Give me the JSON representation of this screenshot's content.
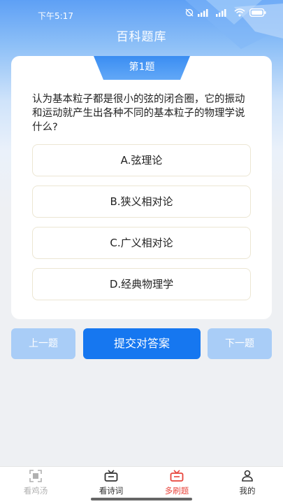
{
  "status_bar": {
    "time": "下午5:17"
  },
  "header": {
    "title": "百科题库"
  },
  "quiz": {
    "number_label": "第1题",
    "question": "认为基本粒子都是很小的弦的闭合圈，它的振动和运动就产生出各种不同的基本粒子的物理学说什么?",
    "options": [
      {
        "label": "A.弦理论"
      },
      {
        "label": "B.狭义相对论"
      },
      {
        "label": "C.广义相对论"
      },
      {
        "label": "D.经典物理学"
      }
    ]
  },
  "actions": {
    "prev_label": "上一题",
    "submit_label": "提交对答案",
    "next_label": "下一题"
  },
  "tabbar": {
    "items": [
      {
        "label": "看鸡汤",
        "icon": "scan-frame-icon"
      },
      {
        "label": "看诗词",
        "icon": "tv-icon"
      },
      {
        "label": "多刷题",
        "icon": "tv-icon"
      },
      {
        "label": "我的",
        "icon": "person-icon"
      }
    ]
  },
  "colors": {
    "accent": "#1677f0",
    "accent_light": "#a9cdf7",
    "active_tab": "#e8453c"
  }
}
